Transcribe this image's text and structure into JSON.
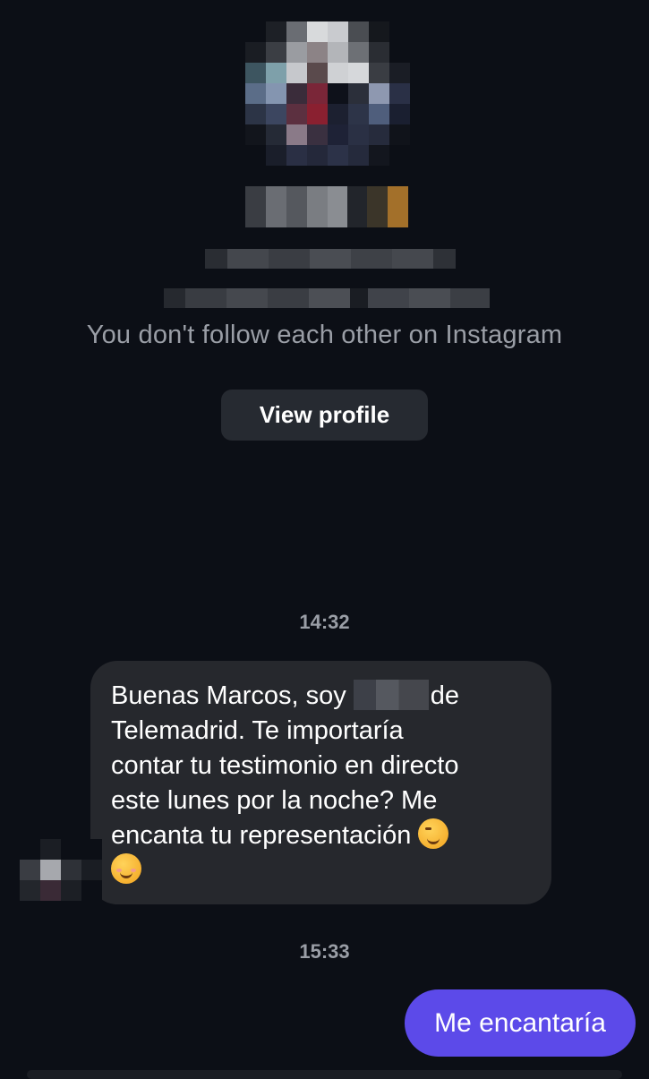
{
  "header": {
    "follow_note": "You don't follow each other on Instagram",
    "view_profile_label": "View profile"
  },
  "messages": [
    {
      "timestamp": "14:32",
      "direction": "incoming",
      "lines": [
        {
          "before": "Buenas Marcos, soy ",
          "after": "de"
        },
        {
          "text": "Telemadrid. Te importaría"
        },
        {
          "text": "contar tu testimonio en directo"
        },
        {
          "text": "este lunes por la noche? Me"
        },
        {
          "text": "encanta tu representación "
        }
      ],
      "emojis": [
        "winking-face",
        "smiling-face"
      ]
    },
    {
      "timestamp": "15:33",
      "direction": "outgoing",
      "text": "Me encantaría"
    }
  ],
  "colors": {
    "background": "#0c0f16",
    "incoming_bubble": "#26282d",
    "outgoing_bubble": "#5c4ae9",
    "button": "#262a31",
    "muted_text": "#9a9ea6"
  }
}
